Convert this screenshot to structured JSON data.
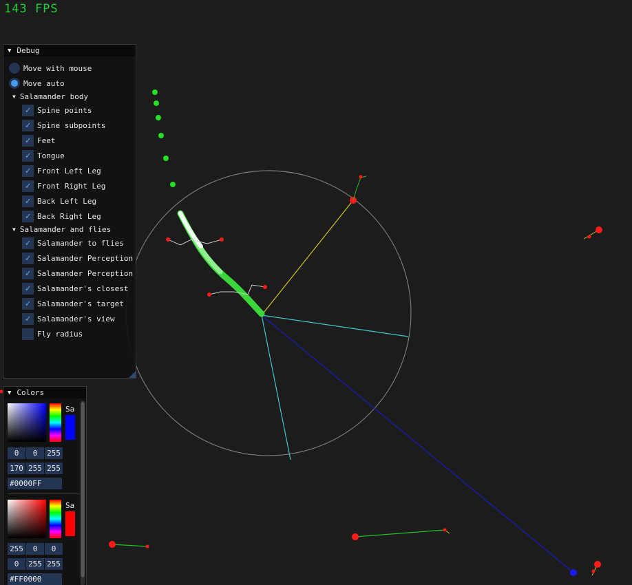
{
  "fps": "143 FPS",
  "debug": {
    "title": "Debug",
    "radios": [
      {
        "label": "Move with mouse",
        "selected": false
      },
      {
        "label": "Move auto",
        "selected": true
      }
    ],
    "groups": [
      {
        "label": "Salamander body",
        "items": [
          {
            "label": "Spine points",
            "checked": true
          },
          {
            "label": "Spine subpoints",
            "checked": true
          },
          {
            "label": "Feet",
            "checked": true
          },
          {
            "label": "Tongue",
            "checked": true
          },
          {
            "label": "Front Left Leg",
            "checked": true
          },
          {
            "label": "Front Right Leg",
            "checked": true
          },
          {
            "label": "Back Left Leg",
            "checked": true
          },
          {
            "label": "Back Right Leg",
            "checked": true
          }
        ]
      },
      {
        "label": "Salamander and flies",
        "items": [
          {
            "label": "Salamander to flies",
            "checked": true
          },
          {
            "label": "Salamander Perception",
            "checked": true
          },
          {
            "label": "Salamander Perception",
            "checked": true
          },
          {
            "label": "Salamander's closest",
            "checked": true
          },
          {
            "label": "Salamander's target",
            "checked": true
          },
          {
            "label": "Salamander's view",
            "checked": true
          },
          {
            "label": "Fly radius",
            "checked": false
          }
        ]
      }
    ]
  },
  "colors": {
    "title": "Colors",
    "pickers": [
      {
        "sa_label": "Sa",
        "hex": "#0000FF",
        "rgb": [
          "0",
          "0",
          "255"
        ],
        "hsv": [
          "170",
          "255",
          "255"
        ],
        "color": "#0000FF"
      },
      {
        "sa_label": "Sa",
        "hex": "#FF0000",
        "rgb": [
          "255",
          "0",
          "0"
        ],
        "hsv": [
          "0",
          "255",
          "255"
        ],
        "color": "#FF0000"
      }
    ]
  },
  "scene_colors": {
    "fly": "#ff1a1a",
    "target_line": "#1a1aa0",
    "target_dot": "#1a1aff",
    "view_lines": "#3fc9c9",
    "closest_line": "#c9c31a",
    "perception_circle": "#7a7a7a",
    "spine_points": "#22e022",
    "fly_trail": "#22c022"
  }
}
